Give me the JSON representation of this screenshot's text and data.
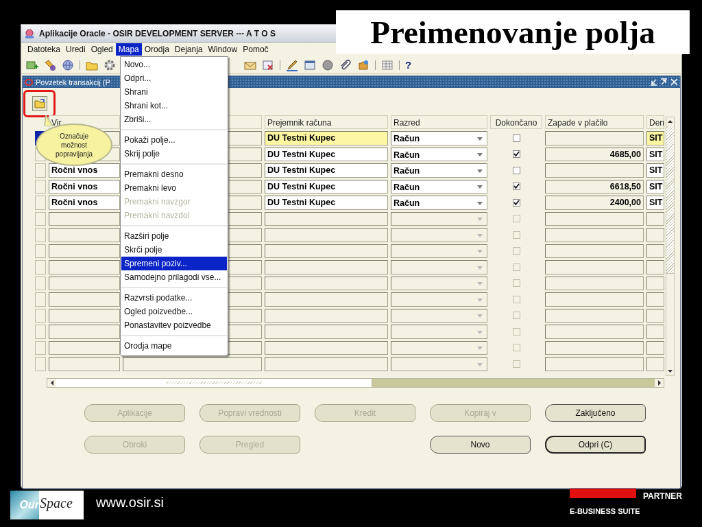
{
  "slide": {
    "title": "Preimenovanje polja",
    "footer": {
      "logo_prefix": "Our",
      "logo_name": "Space",
      "url": "www.osir.si",
      "partner": "PARTNER",
      "suite": "E-BUSINESS SUITE"
    }
  },
  "app": {
    "title": "Aplikacije Oracle - OSIR DEVELOPMENT SERVER --- A T O S",
    "menu": [
      {
        "label": "Datoteka",
        "selected": false
      },
      {
        "label": "Uredi",
        "selected": false
      },
      {
        "label": "Ogled",
        "selected": false
      },
      {
        "label": "Mapa",
        "selected": true
      },
      {
        "label": "Orodja",
        "selected": false
      },
      {
        "label": "Dejanja",
        "selected": false
      },
      {
        "label": "Window",
        "selected": false
      },
      {
        "label": "Pomoč",
        "selected": false
      }
    ],
    "toolbar": {
      "help": "?"
    },
    "form": {
      "title": "Povzetek transakcij (P",
      "columns": [
        "Vir",
        "Prejemnik računa",
        "Razred",
        "Dokončano",
        "Zapade v plačilo",
        "Den"
      ],
      "rows": [
        {
          "selected": true,
          "customer": "DU Testni Kupec",
          "class": "Račun",
          "done": false,
          "currency": "SIT"
        },
        {
          "selected": false,
          "customer": "DU Testni Kupec",
          "class": "Račun",
          "done": true,
          "due": "4685,00",
          "currency": "SIT"
        },
        {
          "selected": false,
          "source": "Ročni vnos",
          "customer": "DU Testni Kupec",
          "class": "Račun",
          "done": false,
          "currency": "SIT"
        },
        {
          "selected": false,
          "source": "Ročni vnos",
          "customer": "DU Testni Kupec",
          "class": "Račun",
          "done": true,
          "due": "6618,50",
          "currency": "SIT"
        },
        {
          "selected": false,
          "source": "Ročni vnos",
          "customer": "DU Testni Kupec",
          "class": "Račun",
          "done": true,
          "due": "2400,00",
          "currency": "SIT"
        },
        {
          "selected": false,
          "done": false
        },
        {
          "selected": false,
          "done": false
        },
        {
          "selected": false,
          "done": false
        },
        {
          "selected": false,
          "done": false
        },
        {
          "selected": false,
          "done": false
        },
        {
          "selected": false,
          "done": false
        },
        {
          "selected": false,
          "done": false
        },
        {
          "selected": false,
          "done": false
        },
        {
          "selected": false,
          "done": false
        },
        {
          "selected": false,
          "done": false
        }
      ],
      "buttons": [
        [
          {
            "label": "Aplikacije",
            "disabled": true,
            "default": false
          },
          {
            "label": "Popravi vrednosti",
            "disabled": true,
            "default": false
          },
          {
            "label": "Kredit",
            "disabled": true,
            "default": false
          },
          {
            "label": "Kopiraj v",
            "disabled": true,
            "default": false
          },
          {
            "label": "Zaključeno",
            "disabled": false,
            "default": false
          }
        ],
        [
          {
            "label": "Obroki",
            "disabled": true,
            "default": false
          },
          {
            "label": "Pregled",
            "disabled": true,
            "default": false
          },
          {
            "label": "Novo",
            "disabled": false,
            "default": false
          },
          {
            "label": "Odpri (C)",
            "disabled": false,
            "default": true
          }
        ]
      ]
    },
    "callout": "Označuje možnost popravljanja",
    "popup": [
      {
        "kind": "item",
        "label": "Novo...",
        "disabled": false,
        "selected": false
      },
      {
        "kind": "item",
        "label": "Odpri...",
        "disabled": false,
        "selected": false
      },
      {
        "kind": "item",
        "label": "Shrani",
        "disabled": false,
        "selected": false
      },
      {
        "kind": "item",
        "label": "Shrani kot...",
        "disabled": false,
        "selected": false
      },
      {
        "kind": "item",
        "label": "Zbriši...",
        "disabled": false,
        "selected": false
      },
      {
        "kind": "separator"
      },
      {
        "kind": "item",
        "label": "Pokaži polje...",
        "disabled": false,
        "selected": false
      },
      {
        "kind": "item",
        "label": "Skrij polje",
        "disabled": false,
        "selected": false
      },
      {
        "kind": "separator"
      },
      {
        "kind": "item",
        "label": "Premakni desno",
        "disabled": false,
        "selected": false
      },
      {
        "kind": "item",
        "label": "Premakni levo",
        "disabled": false,
        "selected": false
      },
      {
        "kind": "item",
        "label": "Premakni navzgor",
        "disabled": true,
        "selected": false
      },
      {
        "kind": "item",
        "label": "Premakni navzdol",
        "disabled": true,
        "selected": false
      },
      {
        "kind": "separator"
      },
      {
        "kind": "item",
        "label": "Razširi polje",
        "disabled": false,
        "selected": false
      },
      {
        "kind": "item",
        "label": "Skrči polje",
        "disabled": false,
        "selected": false
      },
      {
        "kind": "item",
        "label": "Spremeni poziv...",
        "disabled": false,
        "selected": true
      },
      {
        "kind": "item",
        "label": "Samodejno prilagodi vse...",
        "disabled": false,
        "selected": false
      },
      {
        "kind": "separator"
      },
      {
        "kind": "item",
        "label": "Razvrsti podatke...",
        "disabled": false,
        "selected": false
      },
      {
        "kind": "item",
        "label": "Ogled poizvedbe...",
        "disabled": false,
        "selected": false
      },
      {
        "kind": "item",
        "label": "Ponastavitev poizvedbe",
        "disabled": false,
        "selected": false
      },
      {
        "kind": "separator"
      },
      {
        "kind": "item",
        "label": "Orodja mape",
        "disabled": false,
        "selected": false
      }
    ]
  }
}
